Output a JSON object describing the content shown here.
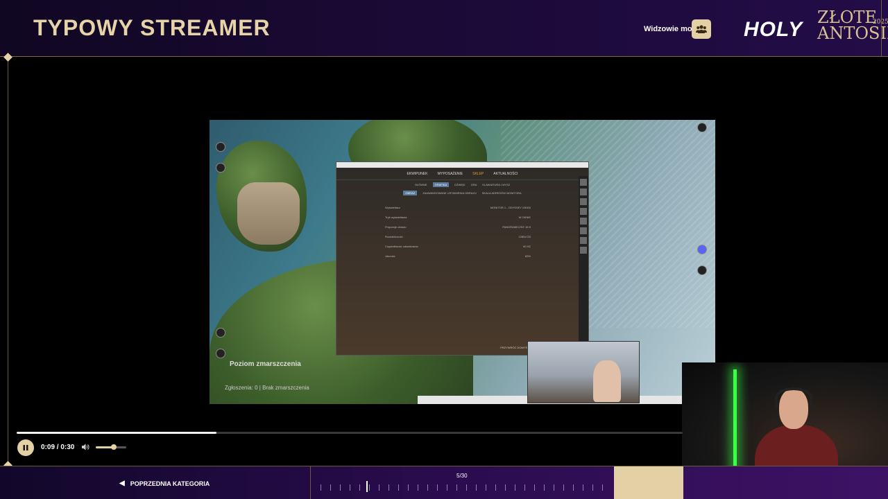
{
  "header": {
    "title": "TYPOWY STREAMER",
    "viewers_label": "Widzowie mogą",
    "viewers_icon": "group-icon"
  },
  "logo": {
    "holy": "HOLY",
    "line1": "ZŁOTE",
    "line2": "ANTOSIE",
    "year": "2025"
  },
  "video": {
    "game_nav": [
      "EKWIPUNEK",
      "WYPOSAŻENIE",
      "SKLEP",
      "AKTUALNOŚCI"
    ],
    "game_nav_active": "SKLEP",
    "game_sub_tabs": [
      "GŁÓWNE",
      "GRAFIKA",
      "DŹWIĘK",
      "GRA",
      "KLAWIATURA I MYSZ"
    ],
    "game_settings_tabs": [
      "OBRAZ",
      "ZAAWANSOWANE USTAWIENIA OBRAZU",
      "SKALA ADRESÓW MONITORA"
    ],
    "settings_rows": [
      {
        "label": "Wyświetlacz",
        "value": "MONITOR 1 - ODYSSEY G5000"
      },
      {
        "label": "Tryb wyświetlania",
        "value": "W OKNIE"
      },
      {
        "label": "Proporcje obrazu",
        "value": "PANORAMICZNY 16:9"
      },
      {
        "label": "Rozdzielczość",
        "value": "1280x720"
      },
      {
        "label": "Częstotliwość odświeżania",
        "value": "60 HZ"
      },
      {
        "label": "Jasność",
        "value": "83%"
      }
    ],
    "footer_action": "PRZYWRÓĆ DOMYŚLNE",
    "overlay_title": "Poziom zmarszczenia",
    "overlay_sub": "Zgłoszenia: 0 | Brak zmarszczenia"
  },
  "player": {
    "time": "0:09 / 0:30",
    "progress": 0.3,
    "volume": 0.6,
    "play_state": "pause-icon",
    "volume_icon": "speaker-icon"
  },
  "bottom_nav": {
    "prev_label": "POPRZEDNIA KATEGORIA",
    "prev_icon": "arrow-left-icon",
    "counter": "5/30",
    "current": 5,
    "total": 30
  },
  "colors": {
    "accent": "#e3d0a5",
    "title_gold": "#e7d3a8",
    "bar_purple": "#2a0c4e"
  }
}
